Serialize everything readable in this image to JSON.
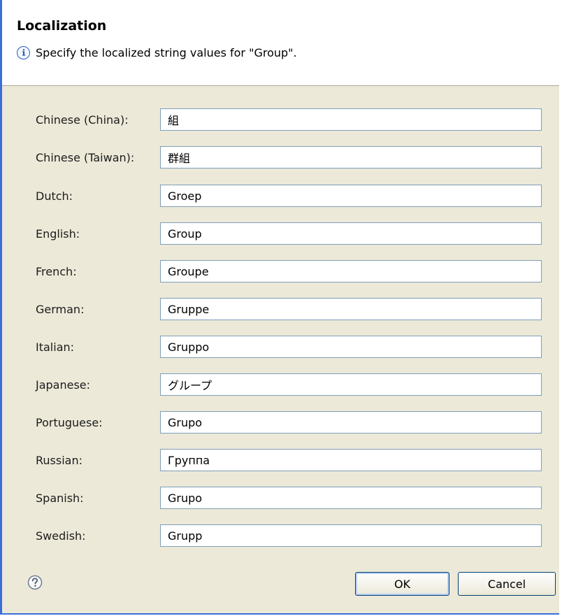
{
  "dialog": {
    "title": "Localization",
    "message": "Specify the localized string values for \"Group\".",
    "icons": {
      "message": "info-icon",
      "help": "help-icon"
    }
  },
  "languages": [
    {
      "label": "Chinese (China):",
      "value": "組"
    },
    {
      "label": "Chinese (Taiwan):",
      "value": "群組"
    },
    {
      "label": "Dutch:",
      "value": "Groep"
    },
    {
      "label": "English:",
      "value": "Group"
    },
    {
      "label": "French:",
      "value": "Groupe"
    },
    {
      "label": "German:",
      "value": "Gruppe"
    },
    {
      "label": "Italian:",
      "value": "Gruppo"
    },
    {
      "label": "Japanese:",
      "value": "グループ"
    },
    {
      "label": "Portuguese:",
      "value": "Grupo"
    },
    {
      "label": "Russian:",
      "value": "Группа"
    },
    {
      "label": "Spanish:",
      "value": "Grupo"
    },
    {
      "label": "Swedish:",
      "value": "Grupp"
    }
  ],
  "buttons": {
    "ok": "OK",
    "cancel": "Cancel"
  }
}
